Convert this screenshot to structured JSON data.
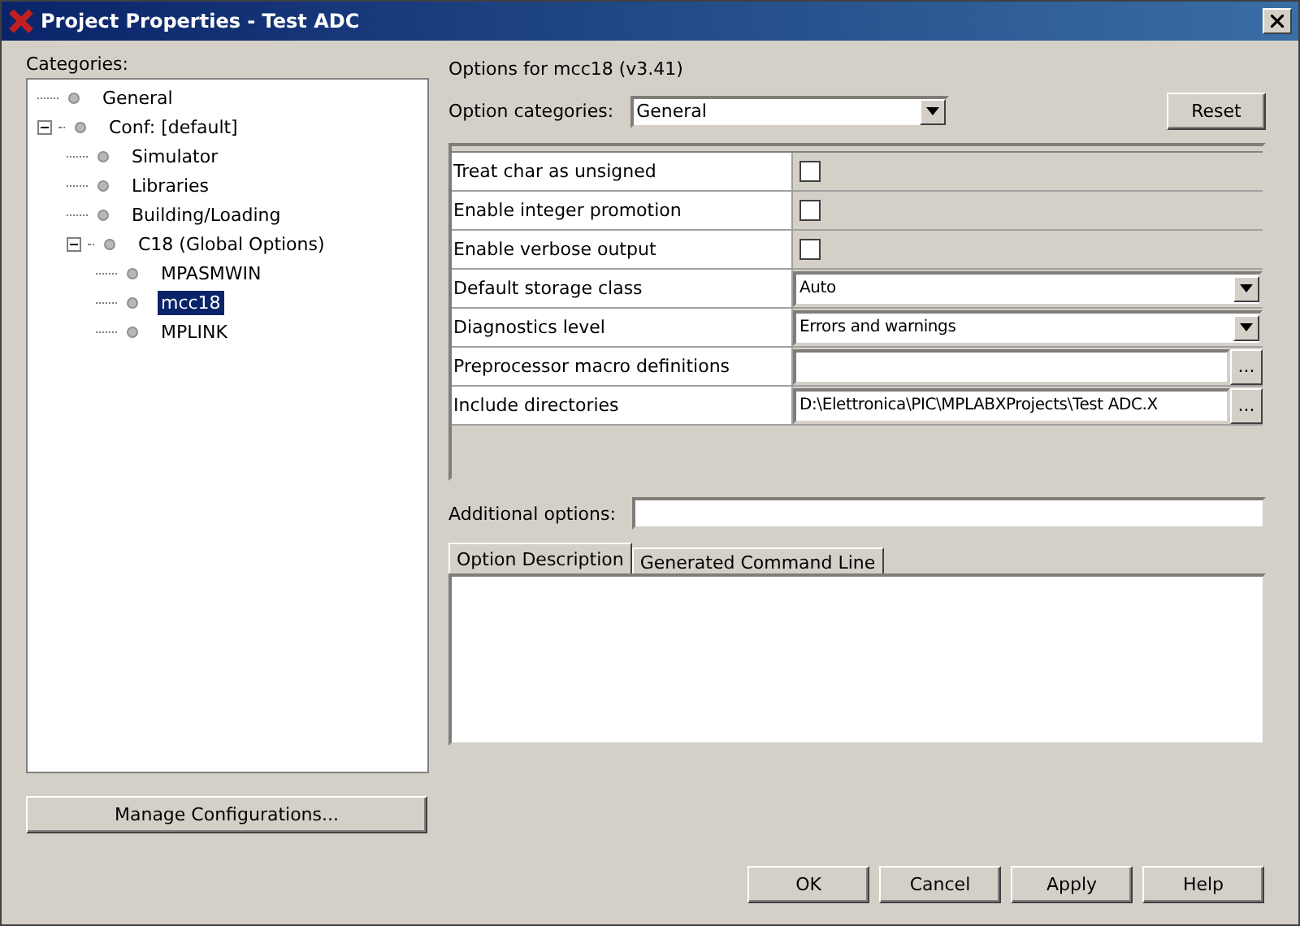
{
  "window": {
    "title": "Project Properties - Test ADC"
  },
  "categories": {
    "label": "Categories:",
    "items": [
      {
        "label": "General",
        "selected": false
      },
      {
        "label": "Conf: [default]",
        "selected": false,
        "expanded": true,
        "children": [
          {
            "label": "Simulator",
            "selected": false
          },
          {
            "label": "Libraries",
            "selected": false
          },
          {
            "label": "Building/Loading",
            "selected": false
          },
          {
            "label": "C18 (Global Options)",
            "selected": false,
            "expanded": true,
            "children": [
              {
                "label": "MPASMWIN",
                "selected": false
              },
              {
                "label": "mcc18",
                "selected": true
              },
              {
                "label": "MPLINK",
                "selected": false
              }
            ]
          }
        ]
      }
    ]
  },
  "manage_button": "Manage Configurations...",
  "options_title": "Options for mcc18 (v3.41)",
  "option_categories": {
    "label": "Option categories:",
    "value": "General"
  },
  "reset_button": "Reset",
  "options": [
    {
      "kind": "checkbox",
      "name": "Treat char as unsigned",
      "checked": false
    },
    {
      "kind": "checkbox",
      "name": "Enable integer promotion",
      "checked": false
    },
    {
      "kind": "checkbox",
      "name": "Enable verbose output",
      "checked": false
    },
    {
      "kind": "dropdown",
      "name": "Default storage class",
      "value": "Auto"
    },
    {
      "kind": "dropdown",
      "name": "Diagnostics level",
      "value": "Errors and warnings"
    },
    {
      "kind": "text",
      "name": "Preprocessor macro definitions",
      "button": "..."
    },
    {
      "kind": "text",
      "name": "Include directories",
      "value": "D:\\Elettronica\\PIC\\MPLABXProjects\\Test ADC.X",
      "button": "..."
    }
  ],
  "additional_options": {
    "label": "Additional options:"
  },
  "tabs": [
    {
      "label": "Option Description",
      "selected": true
    },
    {
      "label": "Generated Command Line",
      "selected": false
    }
  ],
  "buttons": [
    "OK",
    "Cancel",
    "Apply",
    "Help"
  ]
}
